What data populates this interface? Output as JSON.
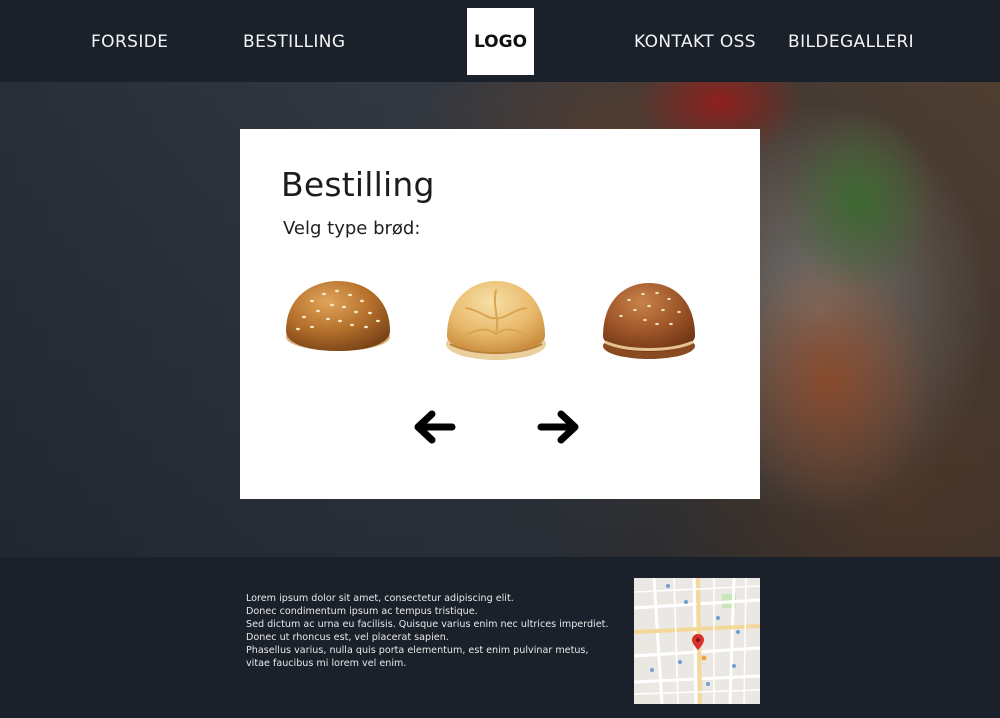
{
  "nav": {
    "forside": "FORSIDE",
    "bestilling": "BESTILLING",
    "logo": "LOGO",
    "kontakt": "KONTAKT OSS",
    "galleri": "BILDEGALLERI"
  },
  "order": {
    "title": "Bestilling",
    "subtitle": "Velg type brød:",
    "options": [
      {
        "icon": "sesame-bun-icon"
      },
      {
        "icon": "plain-bun-icon"
      },
      {
        "icon": "dark-sesame-bun-icon"
      }
    ],
    "prev_icon": "arrow-left-icon",
    "next_icon": "arrow-right-icon"
  },
  "footer": {
    "lines": [
      "Lorem ipsum dolor sit amet, consectetur adipiscing elit.",
      "Donec condimentum ipsum ac tempus tristique.",
      "Sed dictum ac urna eu facilisis. Quisque varius enim nec ultrices imperdiet.",
      "Donec ut rhoncus est, vel placerat sapien.",
      "Phasellus varius, nulla quis porta elementum, est enim pulvinar metus,",
      "vitae faucibus mi lorem vel enim."
    ],
    "map_icon": "map-pin-icon"
  },
  "colors": {
    "nav_bg": "#1a212b",
    "footer_bg": "#1b212a",
    "card_bg": "#ffffff",
    "map_pin": "#d9302c"
  }
}
